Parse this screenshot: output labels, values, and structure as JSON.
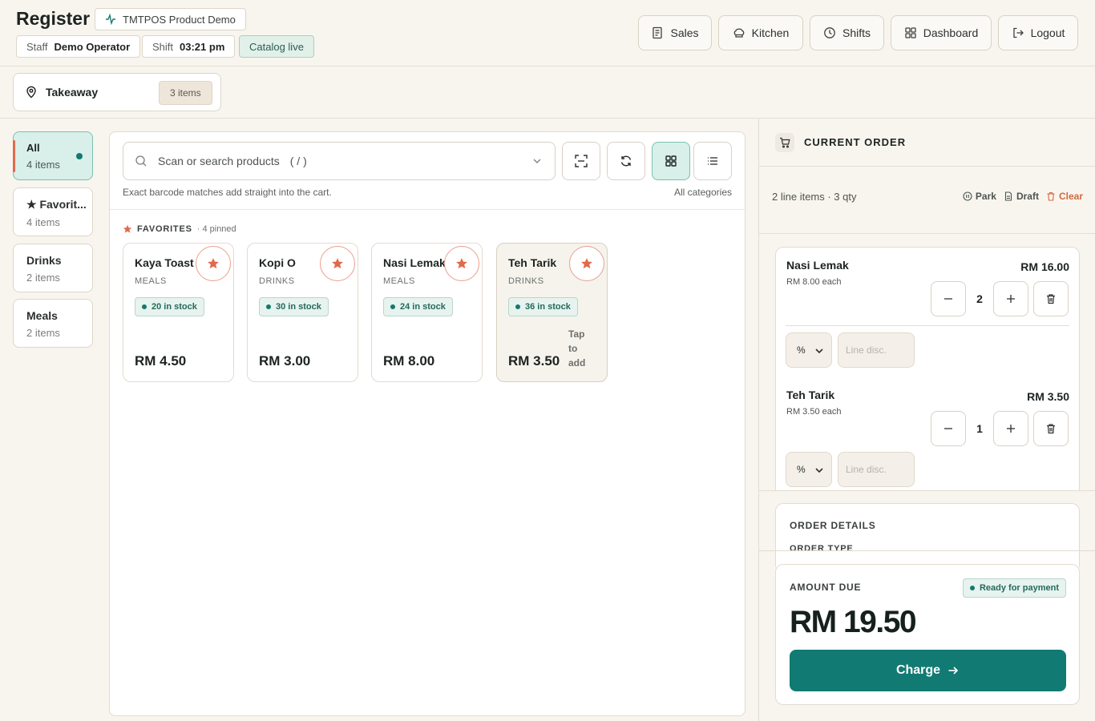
{
  "header": {
    "title": "Register",
    "demo_label": "TMTPOS Product Demo",
    "staff_label": "Staff",
    "staff_value": "Demo Operator",
    "shift_label": "Shift",
    "shift_value": "03:21 pm",
    "catalog_status": "Catalog live",
    "nav": [
      {
        "label": "Sales",
        "icon": "receipt-icon"
      },
      {
        "label": "Kitchen",
        "icon": "chef-hat-icon"
      },
      {
        "label": "Shifts",
        "icon": "clock-icon"
      },
      {
        "label": "Dashboard",
        "icon": "grid-icon"
      },
      {
        "label": "Logout",
        "icon": "logout-icon"
      }
    ]
  },
  "order_type": {
    "label": "Takeaway",
    "count": "3 items",
    "icon": "location-pin-icon"
  },
  "categories": [
    {
      "name": "All",
      "count": "4 items",
      "active": true
    },
    {
      "name": "★ Favorit...",
      "count": "4 items",
      "active": false
    },
    {
      "name": "Drinks",
      "count": "2 items",
      "active": false
    },
    {
      "name": "Meals",
      "count": "2 items",
      "active": false
    }
  ],
  "search": {
    "placeholder": "Scan or search products",
    "shortcut": "( / )",
    "hint": "Exact barcode matches add straight into the cart.",
    "filter": "All categories"
  },
  "favorites": {
    "title": "FAVORITES",
    "pinned": "· 4 pinned"
  },
  "products": [
    {
      "name": "Kaya Toast",
      "category": "MEALS",
      "stock": "20 in stock",
      "price": "RM 4.50"
    },
    {
      "name": "Kopi O",
      "category": "DRINKS",
      "stock": "30 in stock",
      "price": "RM 3.00"
    },
    {
      "name": "Nasi Lemak",
      "category": "MEALS",
      "stock": "24 in stock",
      "price": "RM 8.00"
    },
    {
      "name": "Teh Tarik",
      "category": "DRINKS",
      "stock": "36 in stock",
      "price": "RM 3.50",
      "hint": "Tap to add"
    }
  ],
  "order": {
    "title": "CURRENT ORDER",
    "summary": "2 line items · 3 qty",
    "park": "Park",
    "draft": "Draft",
    "clear": "Clear",
    "lines": [
      {
        "name": "Nasi Lemak",
        "each": "RM 8.00 each",
        "qty": "2",
        "total": "RM 16.00",
        "disc_type": "%",
        "disc_placeholder": "Line disc."
      },
      {
        "name": "Teh Tarik",
        "each": "RM 3.50 each",
        "qty": "1",
        "total": "RM 3.50",
        "disc_type": "%",
        "disc_placeholder": "Line disc."
      }
    ],
    "details_title": "ORDER DETAILS",
    "details_sub": "ORDER TYPE",
    "amount_label": "AMOUNT DUE",
    "status": "Ready for payment",
    "amount": "RM 19.50",
    "charge": "Charge"
  },
  "colors": {
    "accent": "#117a73",
    "favorite": "#e06a4c",
    "background": "#f8f5ef"
  }
}
